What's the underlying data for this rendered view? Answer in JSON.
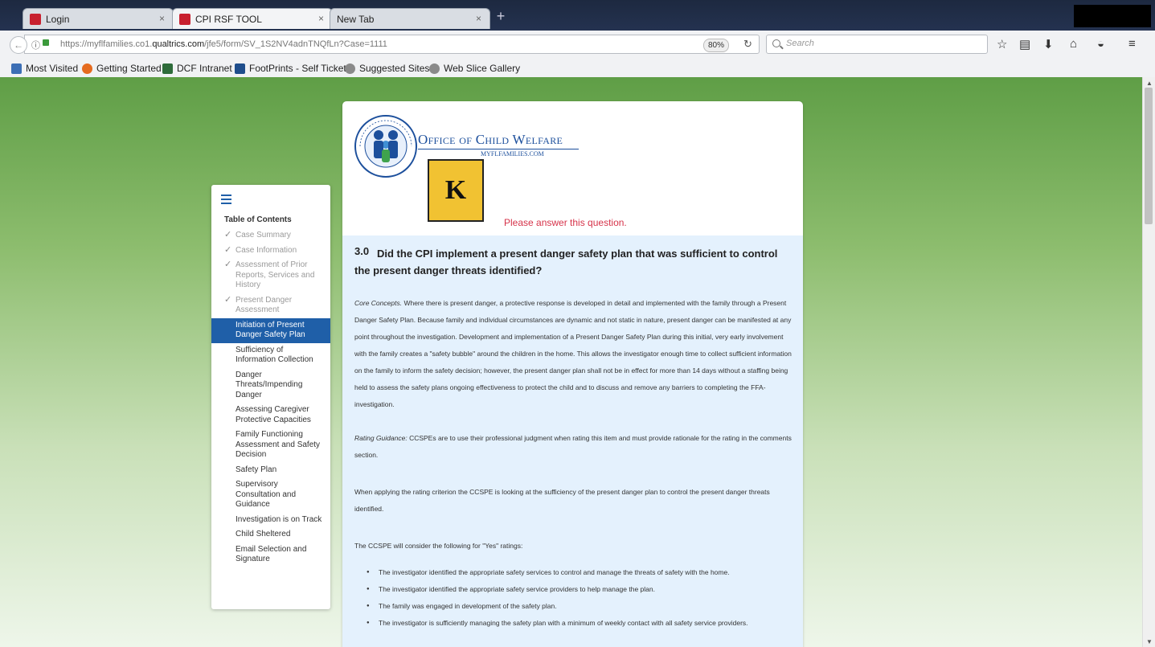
{
  "browser": {
    "tabs": [
      {
        "title": "Login",
        "close": "×"
      },
      {
        "title": "CPI RSF TOOL",
        "close": "×"
      },
      {
        "title": "New Tab",
        "close": "×"
      }
    ],
    "new_tab": "+",
    "url_prefix": "https://myflfamilies.co1.",
    "url_domain": "qualtrics.com",
    "url_path": "/jfe5/form/SV_1S2NV4adnTNQfLn?Case=1111",
    "zoom": "80%",
    "search_placeholder": "Search",
    "toolbar_icons": [
      "star-icon",
      "reading-list-icon",
      "download-icon",
      "home-icon",
      "pocket-icon",
      "menu-icon"
    ],
    "bookmarks": [
      "Most Visited",
      "Getting Started",
      "DCF Intranet",
      "FootPrints - Self Ticket",
      "Suggested Sites",
      "Web Slice Gallery"
    ]
  },
  "toc": {
    "title": "Table of Contents",
    "items": [
      {
        "label": "Case Summary",
        "state": "done"
      },
      {
        "label": "Case Information",
        "state": "done"
      },
      {
        "label": "Assessment of Prior Reports, Services and History",
        "state": "done"
      },
      {
        "label": "Present Danger Assessment",
        "state": "done"
      },
      {
        "label": "Initiation of Present Danger Safety Plan",
        "state": "active"
      },
      {
        "label": "Sufficiency of Information Collection",
        "state": "todo"
      },
      {
        "label": "Danger Threats/Impending Danger",
        "state": "todo"
      },
      {
        "label": "Assessing Caregiver Protective Capacities",
        "state": "todo"
      },
      {
        "label": "Family Functioning Assessment and Safety Decision",
        "state": "todo"
      },
      {
        "label": "Safety Plan",
        "state": "todo"
      },
      {
        "label": "Supervisory Consultation and Guidance",
        "state": "todo"
      },
      {
        "label": "Investigation is on Track",
        "state": "todo"
      },
      {
        "label": "Child Sheltered",
        "state": "todo"
      },
      {
        "label": "Email Selection and Signature",
        "state": "todo"
      }
    ]
  },
  "header": {
    "org_name": "Office of Child Welfare",
    "org_site": "MYFLFAMILIES.COM",
    "seal_text": "FLORIDA DEPARTMENT OF CHILDREN AND FAMILIES",
    "badge": "K",
    "validation_message": "Please answer this question."
  },
  "question": {
    "number": "3.0",
    "text": "Did the CPI implement a present danger safety plan that was sufficient to control the present danger threats identified?",
    "core_concepts_label": "Core Concepts.",
    "core_concepts_text": "Where there is present danger, a protective response is developed in detail and implemented with the family through a Present Danger Safety Plan.  Because family and individual circumstances are dynamic and not static in nature, present danger can be manifested at any point throughout the investigation.  Development and implementation of a Present Danger Safety Plan during this initial, very early involvement with the family creates a \"safety bubble\" around the children in the home.  This allows the investigator enough time to collect sufficient information on the family to inform the safety decision; however, the present danger plan shall not be in effect for more than 14 days without a staffing being held to assess the safety plans ongoing effectiveness to protect the child and to discuss and remove any barriers to completing the FFA-investigation.",
    "rating_guidance_label": "Rating Guidance:",
    "rating_guidance_text": "CCSPEs are to use their professional judgment when rating this item and must provide rationale for the rating in the comments section.",
    "criterion_text": "When applying the rating criterion the CCSPE is looking at the sufficiency of the present danger plan to control the present danger threats identified.",
    "yes_intro": "The CCSPE will consider the following for \"Yes\" ratings:",
    "yes_bullets": [
      "The investigator identified the appropriate safety services to control and manage the threats of safety with the home.",
      "The investigator identified the appropriate safety service providers to help manage the plan.",
      "The family was engaged in development of the safety plan.",
      "The investigator is sufficiently managing the safety plan with a minimum of weekly contact with all safety service providers."
    ]
  },
  "colors": {
    "accent": "#1f5fa8",
    "validation": "#d6334a",
    "badge": "#f1c232",
    "question_bg": "#e4f1fd",
    "page_green": "#5f9e46"
  }
}
